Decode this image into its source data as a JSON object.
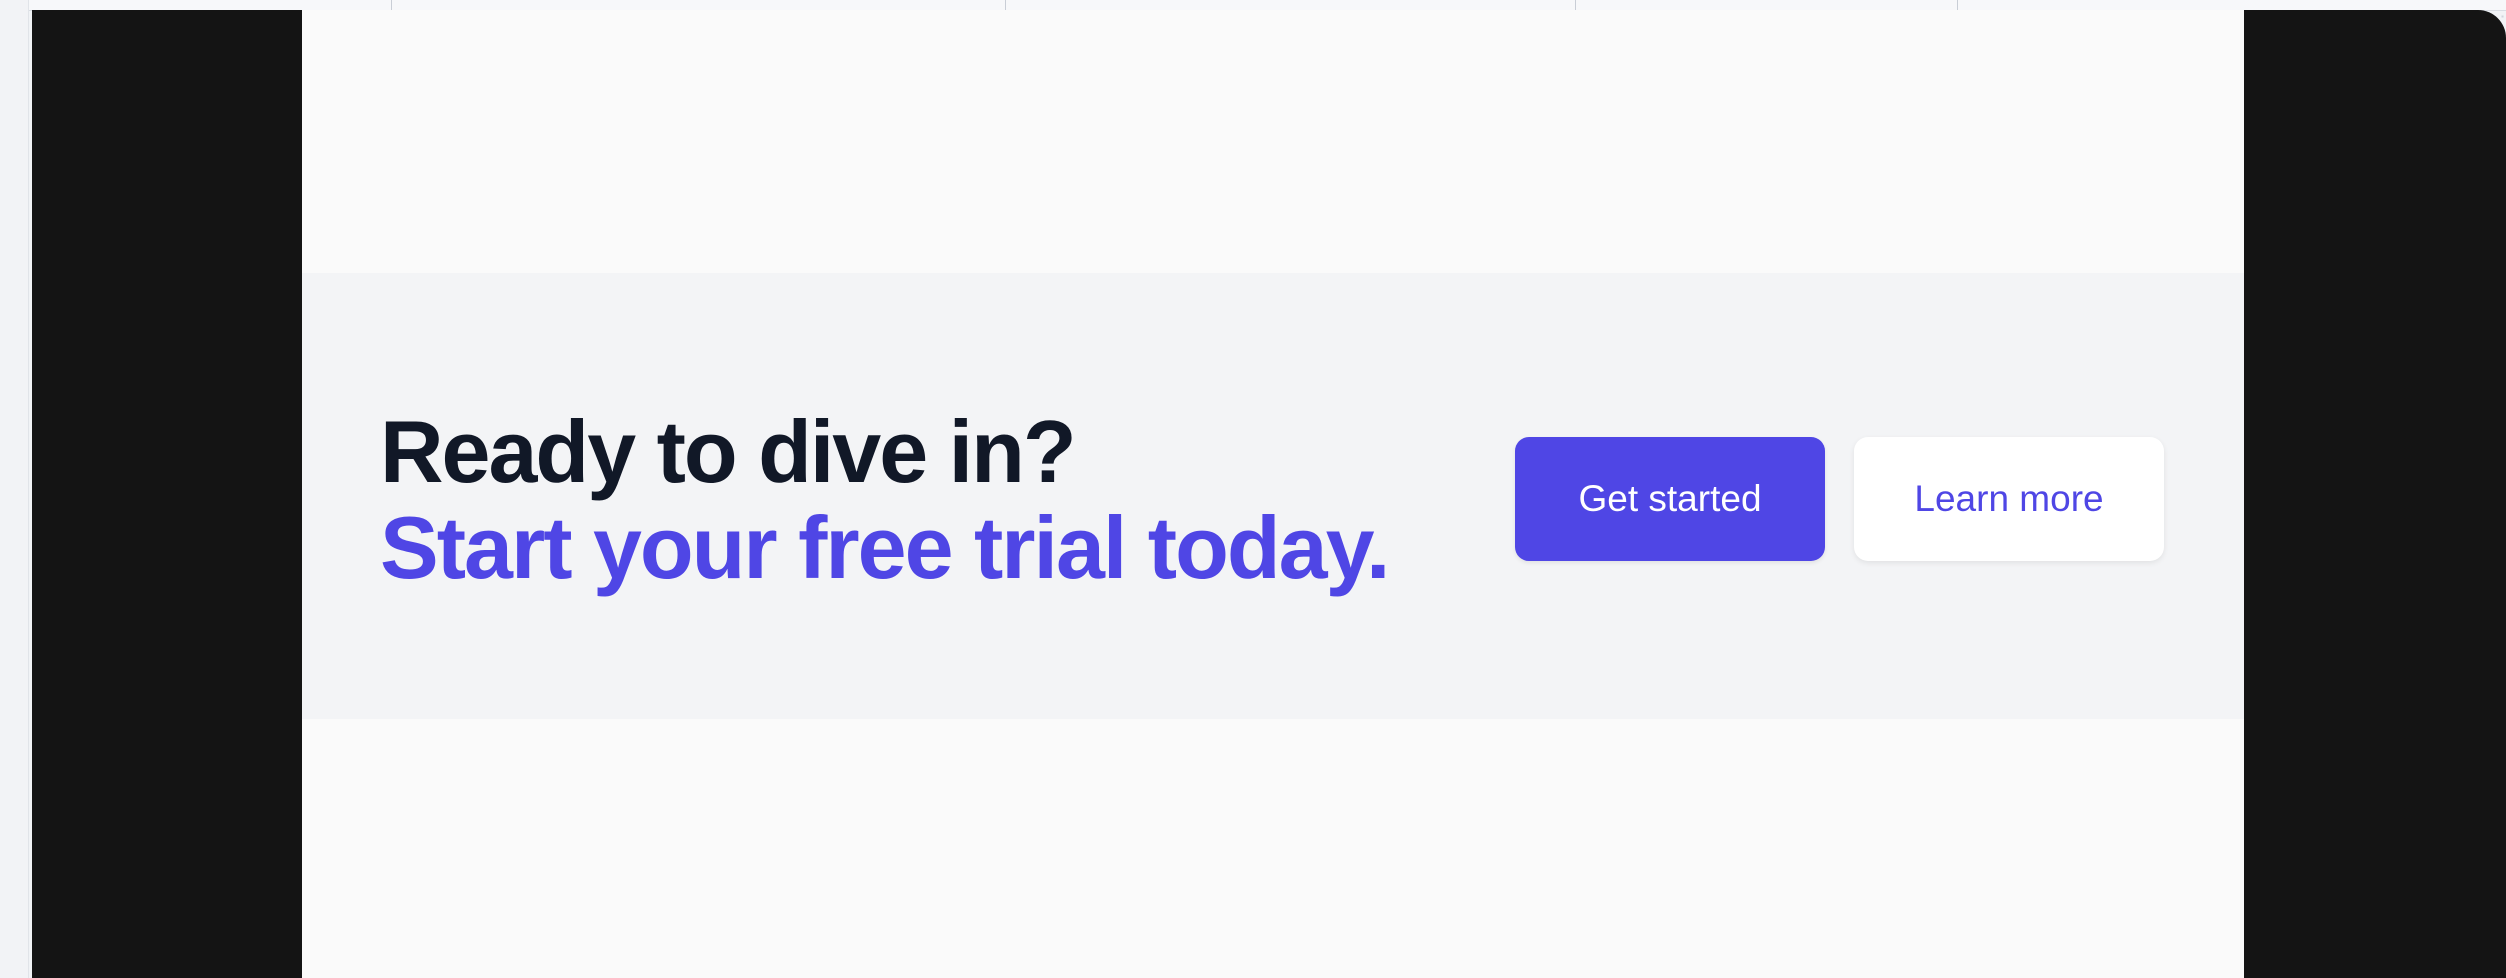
{
  "cta": {
    "title_line1": "Ready to dive in?",
    "title_line2": "Start your free trial today.",
    "primary_button": "Get started",
    "secondary_button": "Learn more"
  },
  "colors": {
    "accent": "#4f46e5",
    "heading": "#111827",
    "section_bg": "#f3f4f6",
    "frame": "#141414"
  }
}
